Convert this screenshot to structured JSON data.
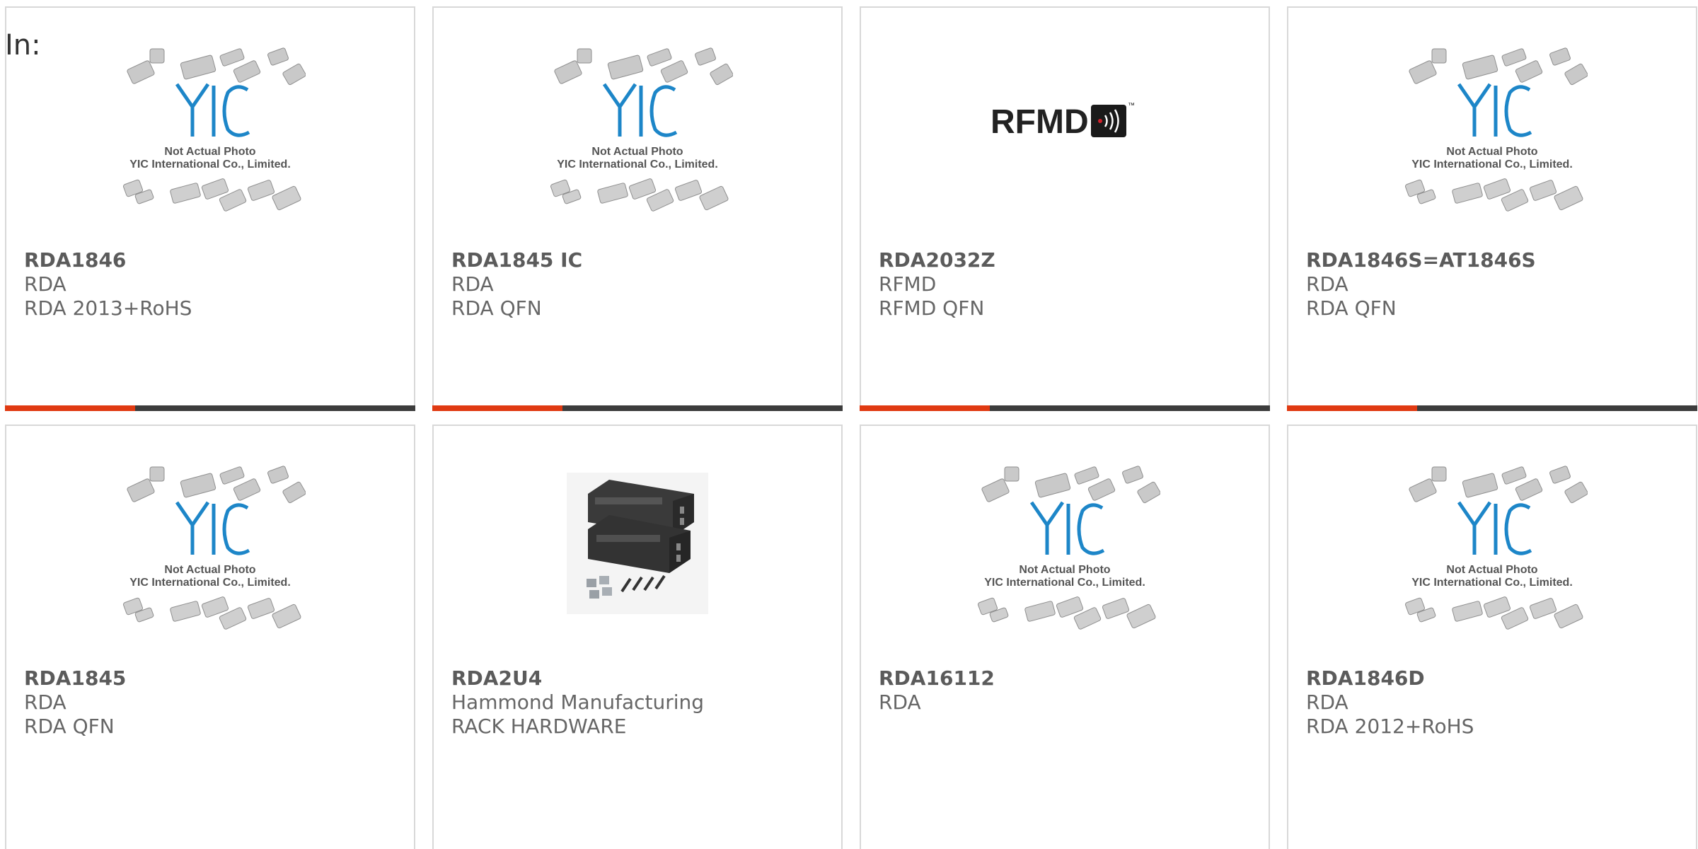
{
  "header": {
    "in_label": "In:"
  },
  "placeholder_image": {
    "line1": "Not Actual Photo",
    "line2": "YIC International Co., Limited.",
    "logo_text": "YIC",
    "logo_color": "#1d86c8"
  },
  "rfmd_logo": {
    "text": "RFMD",
    "tm": "™"
  },
  "colors": {
    "accent": "#e03a12",
    "bar": "#3c3c3c",
    "border": "#d8d8d8",
    "text": "#666666"
  },
  "cards": [
    {
      "part": "RDA1846",
      "manufacturer": "RDA",
      "description": "RDA 2013+RoHS",
      "image": "yic-placeholder"
    },
    {
      "part": "RDA1845 IC",
      "manufacturer": "RDA",
      "description": "RDA QFN",
      "image": "yic-placeholder"
    },
    {
      "part": "RDA2032Z",
      "manufacturer": "RFMD",
      "description": "RFMD QFN",
      "image": "rfmd-logo"
    },
    {
      "part": "RDA1846S=AT1846S",
      "manufacturer": "RDA",
      "description": "RDA QFN",
      "image": "yic-placeholder"
    },
    {
      "part": "RDA1845",
      "manufacturer": "RDA",
      "description": "RDA QFN",
      "image": "yic-placeholder"
    },
    {
      "part": "RDA2U4",
      "manufacturer": "Hammond Manufacturing",
      "description": "RACK HARDWARE",
      "image": "rack-brackets"
    },
    {
      "part": "RDA16112",
      "manufacturer": "RDA",
      "description": "",
      "image": "yic-placeholder"
    },
    {
      "part": "RDA1846D",
      "manufacturer": "RDA",
      "description": "RDA 2012+RoHS",
      "image": "yic-placeholder"
    }
  ]
}
